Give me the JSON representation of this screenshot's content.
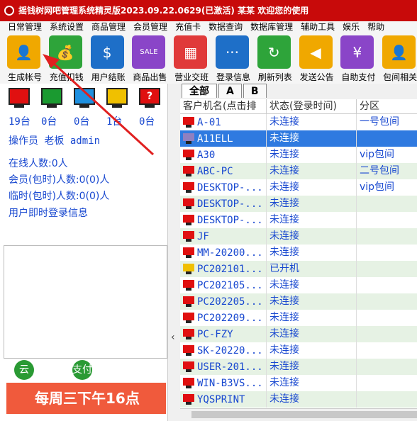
{
  "window": {
    "title": "摇钱树网吧管理系统精灵版2023.09.22.0629(已激活)  某某  欢迎您的使用"
  },
  "menu": [
    "日常管理",
    "系统设置",
    "商品管理",
    "会员管理",
    "充值卡",
    "数据查询",
    "数据库管理",
    "辅助工具",
    "娱乐",
    "帮助"
  ],
  "toolbar": [
    {
      "label": "生成帐号",
      "icon": "user-icon",
      "color": "#f0a800"
    },
    {
      "label": "充值扣钱",
      "icon": "money-bag-icon",
      "color": "#2ea43a"
    },
    {
      "label": "用户结账",
      "icon": "dollar-icon",
      "color": "#1e6fc8"
    },
    {
      "label": "商品出售",
      "icon": "sale-tag-icon",
      "color": "#8a45c8"
    },
    {
      "label": "营业交班",
      "icon": "register-icon",
      "color": "#e03a3a"
    },
    {
      "label": "登录信息",
      "icon": "chat-icon",
      "color": "#1e6fc8"
    },
    {
      "label": "刷新列表",
      "icon": "refresh-icon",
      "color": "#2ea43a"
    },
    {
      "label": "发送公告",
      "icon": "megaphone-icon",
      "color": "#f0a800"
    },
    {
      "label": "自助支付",
      "icon": "yen-icon",
      "color": "#8a45c8"
    },
    {
      "label": "包间相关",
      "icon": "user-icon",
      "color": "#f0a800"
    }
  ],
  "status_monitors": [
    {
      "count": "19台",
      "color": "#e01010"
    },
    {
      "count": "0台",
      "color": "#1a9a30"
    },
    {
      "count": "0台",
      "color": "#1e90e0"
    },
    {
      "count": "1台",
      "color": "#f0c000"
    },
    {
      "count": "0台",
      "color": "#1a9a30",
      "symbol": "?"
    }
  ],
  "operator": "操作员 老板 admin",
  "stats": {
    "online": "在线人数:0人",
    "members": "会员(包时)人数:0(0)人",
    "temp": "临时(包时)人数:0(0)人",
    "login_info": "用户即时登录信息"
  },
  "bottom_buttons": [
    "云",
    "支付"
  ],
  "banner": "每周三下午16点",
  "tabs": [
    "全部",
    "A",
    "B"
  ],
  "columns": [
    "客户机名(点击排",
    "状态(登录时间)",
    "分区"
  ],
  "rows": [
    {
      "name": "A-01",
      "status": "未连接",
      "zone": "一号包间",
      "pc": "#e01010"
    },
    {
      "name": "A11ELL",
      "status": "未连接",
      "zone": "",
      "pc": "#9080c0",
      "selected": true
    },
    {
      "name": "A30",
      "status": "未连接",
      "zone": "vip包间",
      "pc": "#e01010"
    },
    {
      "name": "ABC-PC",
      "status": "未连接",
      "zone": "二号包间",
      "pc": "#e01010"
    },
    {
      "name": "DESKTOP-...",
      "status": "未连接",
      "zone": "vip包间",
      "pc": "#e01010"
    },
    {
      "name": "DESKTOP-...",
      "status": "未连接",
      "zone": "",
      "pc": "#e01010"
    },
    {
      "name": "DESKTOP-...",
      "status": "未连接",
      "zone": "",
      "pc": "#e01010"
    },
    {
      "name": "JF",
      "status": "未连接",
      "zone": "",
      "pc": "#e01010"
    },
    {
      "name": "MM-20200...",
      "status": "未连接",
      "zone": "",
      "pc": "#e01010"
    },
    {
      "name": "PC202101...",
      "status": "已开机",
      "zone": "",
      "pc": "#f0c000"
    },
    {
      "name": "PC202105...",
      "status": "未连接",
      "zone": "",
      "pc": "#e01010"
    },
    {
      "name": "PC202205...",
      "status": "未连接",
      "zone": "",
      "pc": "#e01010"
    },
    {
      "name": "PC202209...",
      "status": "未连接",
      "zone": "",
      "pc": "#e01010"
    },
    {
      "name": "PC-FZY",
      "status": "未连接",
      "zone": "",
      "pc": "#e01010"
    },
    {
      "name": "SK-20220...",
      "status": "未连接",
      "zone": "",
      "pc": "#e01010"
    },
    {
      "name": "USER-201...",
      "status": "未连接",
      "zone": "",
      "pc": "#e01010"
    },
    {
      "name": "WIN-B3VS...",
      "status": "未连接",
      "zone": "",
      "pc": "#e01010"
    },
    {
      "name": "YQSPRINT",
      "status": "未连接",
      "zone": "",
      "pc": "#e01010"
    }
  ]
}
